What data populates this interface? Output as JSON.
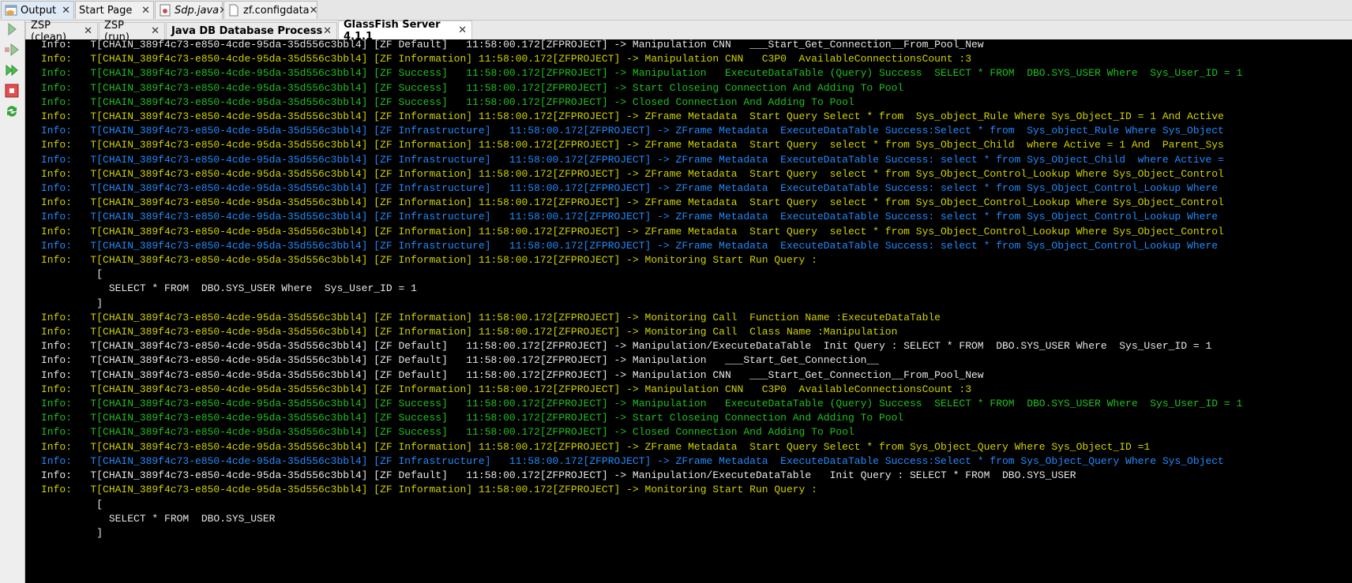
{
  "top_tabs": [
    {
      "label": "Output",
      "icon": "output-window-icon",
      "active": true
    },
    {
      "label": "Start Page",
      "icon": "",
      "active": false
    },
    {
      "label": "Sdp.java",
      "icon": "java-file-icon",
      "active": false
    },
    {
      "label": "zf.configdata",
      "icon": "file-icon",
      "active": false
    }
  ],
  "output_tabs": [
    {
      "label": "ZSP (clean)"
    },
    {
      "label": "ZSP (run)"
    },
    {
      "label": "Java DB Database Process"
    },
    {
      "label": "GlassFish Server 4.1.1"
    }
  ],
  "close_glyph": "✕",
  "toolbar": [
    "rerun-icon",
    "rerun-with-options-icon",
    "resume-icon",
    "stop-icon",
    "refresh-icon"
  ],
  "colors": {
    "default": "#e6e6e6",
    "information": "#d2d200",
    "success": "#1fc01f",
    "infrastructure": "#1e8cff",
    "background": "#000000"
  },
  "lines": [
    {
      "c": "white",
      "t": "Info:   T[CHAIN_389f4c73-e850-4cde-95da-35d556c3bbl4] [ZF Default]   11:58:00.172[ZFPROJECT] -> Manipulation CNN   ___Start_Get_Connection__From_Pool_New"
    },
    {
      "c": "yellow",
      "t": "Info:   T[CHAIN_389f4c73-e850-4cde-95da-35d556c3bbl4] [ZF Information] 11:58:00.172[ZFPROJECT] -> Manipulation CNN   C3P0  AvailableConnectionsCount :3"
    },
    {
      "c": "green",
      "t": "Info:   T[CHAIN_389f4c73-e850-4cde-95da-35d556c3bbl4] [ZF Success]   11:58:00.172[ZFPROJECT] -> Manipulation   ExecuteDataTable (Query) Success  SELECT * FROM  DBO.SYS_USER Where  Sys_User_ID = 1"
    },
    {
      "c": "green",
      "t": "Info:   T[CHAIN_389f4c73-e850-4cde-95da-35d556c3bbl4] [ZF Success]   11:58:00.172[ZFPROJECT] -> Start Closeing Connection And Adding To Pool"
    },
    {
      "c": "green",
      "t": "Info:   T[CHAIN_389f4c73-e850-4cde-95da-35d556c3bbl4] [ZF Success]   11:58:00.172[ZFPROJECT] -> Closed Connection And Adding To Pool"
    },
    {
      "c": "yellow",
      "t": "Info:   T[CHAIN_389f4c73-e850-4cde-95da-35d556c3bbl4] [ZF Information] 11:58:00.172[ZFPROJECT] -> ZFrame Metadata  Start Query Select * from  Sys_object_Rule Where Sys_Object_ID = 1 And Active"
    },
    {
      "c": "blue",
      "t": "Info:   T[CHAIN_389f4c73-e850-4cde-95da-35d556c3bbl4] [ZF Infrastructure]   11:58:00.172[ZFPROJECT] -> ZFrame Metadata  ExecuteDataTable Success:Select * from  Sys_object_Rule Where Sys_Object"
    },
    {
      "c": "yellow",
      "t": "Info:   T[CHAIN_389f4c73-e850-4cde-95da-35d556c3bbl4] [ZF Information] 11:58:00.172[ZFPROJECT] -> ZFrame Metadata  Start Query  select * from Sys_Object_Child  where Active = 1 And  Parent_Sys"
    },
    {
      "c": "blue",
      "t": "Info:   T[CHAIN_389f4c73-e850-4cde-95da-35d556c3bbl4] [ZF Infrastructure]   11:58:00.172[ZFPROJECT] -> ZFrame Metadata  ExecuteDataTable Success: select * from Sys_Object_Child  where Active ="
    },
    {
      "c": "yellow",
      "t": "Info:   T[CHAIN_389f4c73-e850-4cde-95da-35d556c3bbl4] [ZF Information] 11:58:00.172[ZFPROJECT] -> ZFrame Metadata  Start Query  select * from Sys_Object_Control_Lookup Where Sys_Object_Control"
    },
    {
      "c": "blue",
      "t": "Info:   T[CHAIN_389f4c73-e850-4cde-95da-35d556c3bbl4] [ZF Infrastructure]   11:58:00.172[ZFPROJECT] -> ZFrame Metadata  ExecuteDataTable Success: select * from Sys_Object_Control_Lookup Where"
    },
    {
      "c": "yellow",
      "t": "Info:   T[CHAIN_389f4c73-e850-4cde-95da-35d556c3bbl4] [ZF Information] 11:58:00.172[ZFPROJECT] -> ZFrame Metadata  Start Query  select * from Sys_Object_Control_Lookup Where Sys_Object_Control"
    },
    {
      "c": "blue",
      "t": "Info:   T[CHAIN_389f4c73-e850-4cde-95da-35d556c3bbl4] [ZF Infrastructure]   11:58:00.172[ZFPROJECT] -> ZFrame Metadata  ExecuteDataTable Success: select * from Sys_Object_Control_Lookup Where"
    },
    {
      "c": "yellow",
      "t": "Info:   T[CHAIN_389f4c73-e850-4cde-95da-35d556c3bbl4] [ZF Information] 11:58:00.172[ZFPROJECT] -> ZFrame Metadata  Start Query  select * from Sys_Object_Control_Lookup Where Sys_Object_Control"
    },
    {
      "c": "blue",
      "t": "Info:   T[CHAIN_389f4c73-e850-4cde-95da-35d556c3bbl4] [ZF Infrastructure]   11:58:00.172[ZFPROJECT] -> ZFrame Metadata  ExecuteDataTable Success: select * from Sys_Object_Control_Lookup Where"
    },
    {
      "c": "yellow",
      "t": "Info:   T[CHAIN_389f4c73-e850-4cde-95da-35d556c3bbl4] [ZF Information] 11:58:00.172[ZFPROJECT] -> Monitoring Start Run Query :"
    },
    {
      "c": "white",
      "t": "         ["
    },
    {
      "c": "white",
      "t": "           SELECT * FROM  DBO.SYS_USER Where  Sys_User_ID = 1"
    },
    {
      "c": "white",
      "t": "         ]"
    },
    {
      "c": "yellow",
      "t": "Info:   T[CHAIN_389f4c73-e850-4cde-95da-35d556c3bbl4] [ZF Information] 11:58:00.172[ZFPROJECT] -> Monitoring Call  Function Name :ExecuteDataTable"
    },
    {
      "c": "yellow",
      "t": "Info:   T[CHAIN_389f4c73-e850-4cde-95da-35d556c3bbl4] [ZF Information] 11:58:00.172[ZFPROJECT] -> Monitoring Call  Class Name :Manipulation"
    },
    {
      "c": "white",
      "t": "Info:   T[CHAIN_389f4c73-e850-4cde-95da-35d556c3bbl4] [ZF Default]   11:58:00.172[ZFPROJECT] -> Manipulation/ExecuteDataTable  Init Query : SELECT * FROM  DBO.SYS_USER Where  Sys_User_ID = 1"
    },
    {
      "c": "white",
      "t": "Info:   T[CHAIN_389f4c73-e850-4cde-95da-35d556c3bbl4] [ZF Default]   11:58:00.172[ZFPROJECT] -> Manipulation   ___Start_Get_Connection__"
    },
    {
      "c": "white",
      "t": "Info:   T[CHAIN_389f4c73-e850-4cde-95da-35d556c3bbl4] [ZF Default]   11:58:00.172[ZFPROJECT] -> Manipulation CNN   ___Start_Get_Connection__From_Pool_New"
    },
    {
      "c": "yellow",
      "t": "Info:   T[CHAIN_389f4c73-e850-4cde-95da-35d556c3bbl4] [ZF Information] 11:58:00.172[ZFPROJECT] -> Manipulation CNN   C3P0  AvailableConnectionsCount :3"
    },
    {
      "c": "green",
      "t": "Info:   T[CHAIN_389f4c73-e850-4cde-95da-35d556c3bbl4] [ZF Success]   11:58:00.172[ZFPROJECT] -> Manipulation   ExecuteDataTable (Query) Success  SELECT * FROM  DBO.SYS_USER Where  Sys_User_ID = 1"
    },
    {
      "c": "green",
      "t": "Info:   T[CHAIN_389f4c73-e850-4cde-95da-35d556c3bbl4] [ZF Success]   11:58:00.172[ZFPROJECT] -> Start Closeing Connection And Adding To Pool"
    },
    {
      "c": "green",
      "t": "Info:   T[CHAIN_389f4c73-e850-4cde-95da-35d556c3bbl4] [ZF Success]   11:58:00.172[ZFPROJECT] -> Closed Connection And Adding To Pool"
    },
    {
      "c": "yellow",
      "t": "Info:   T[CHAIN_389f4c73-e850-4cde-95da-35d556c3bbl4] [ZF Information] 11:58:00.172[ZFPROJECT] -> ZFrame Metadata  Start Query Select * from Sys_Object_Query Where Sys_Object_ID =1"
    },
    {
      "c": "blue",
      "t": "Info:   T[CHAIN_389f4c73-e850-4cde-95da-35d556c3bbl4] [ZF Infrastructure]   11:58:00.172[ZFPROJECT] -> ZFrame Metadata  ExecuteDataTable Success:Select * from Sys_Object_Query Where Sys_Object"
    },
    {
      "c": "white",
      "t": "Info:   T[CHAIN_389f4c73-e850-4cde-95da-35d556c3bbl4] [ZF Default]   11:58:00.172[ZFPROJECT] -> Manipulation/ExecuteDataTable   Init Query : SELECT * FROM  DBO.SYS_USER"
    },
    {
      "c": "yellow",
      "t": "Info:   T[CHAIN_389f4c73-e850-4cde-95da-35d556c3bbl4] [ZF Information] 11:58:00.172[ZFPROJECT] -> Monitoring Start Run Query :"
    },
    {
      "c": "white",
      "t": "         ["
    },
    {
      "c": "white",
      "t": "           SELECT * FROM  DBO.SYS_USER"
    },
    {
      "c": "white",
      "t": "         ]"
    }
  ]
}
